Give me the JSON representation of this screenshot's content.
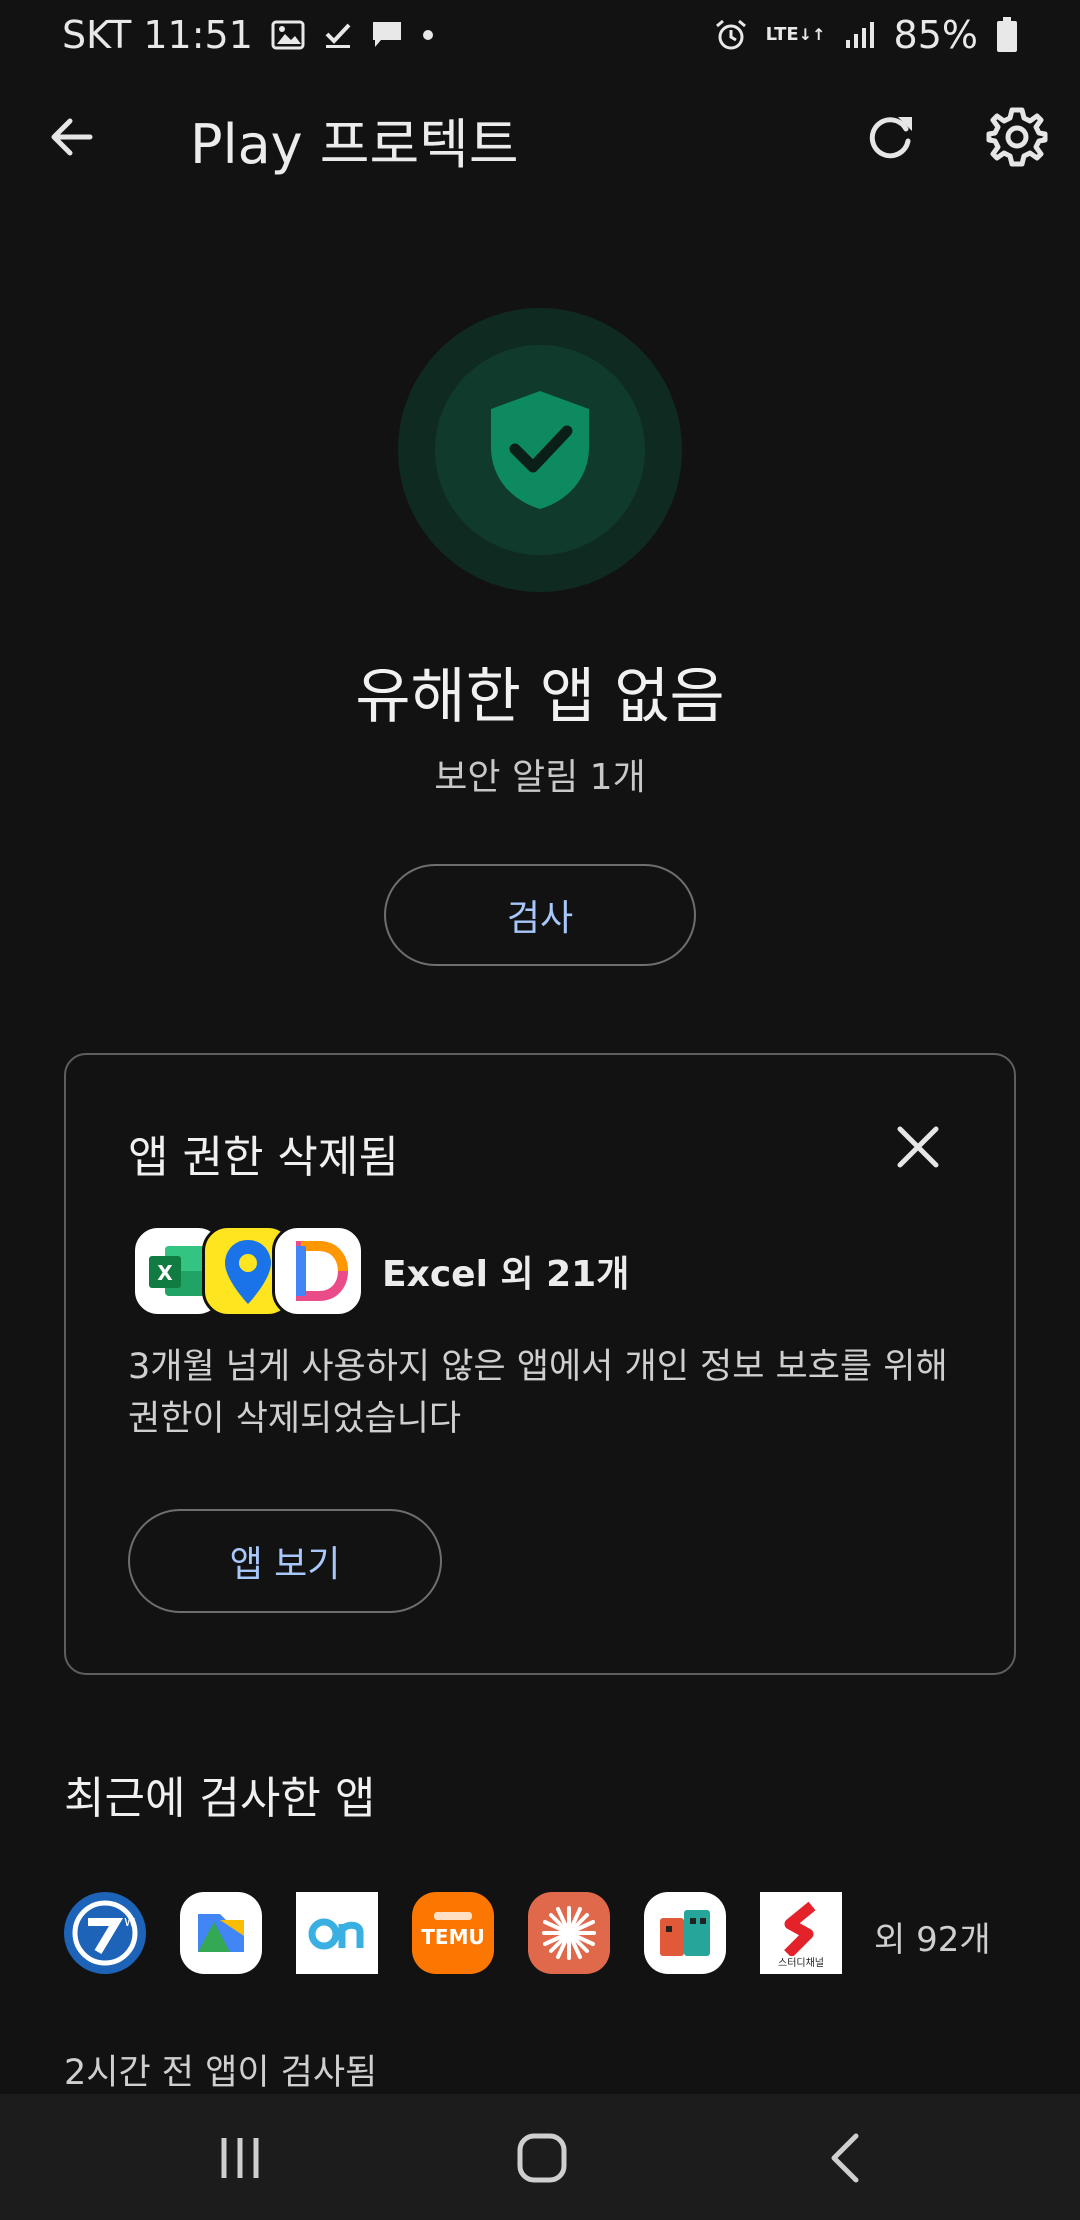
{
  "status_bar": {
    "carrier_time": "SKT 11:51",
    "lte": "LTE",
    "battery": "85%",
    "icons": [
      "gallery-icon",
      "checkbox-icon",
      "message-icon",
      "dot-icon",
      "alarm-icon",
      "lte-icon",
      "signal-icon",
      "battery-icon"
    ]
  },
  "app_bar": {
    "title": "Play 프로텍트"
  },
  "hero": {
    "title": "유해한 앱 없음",
    "subtitle": "보안 알림 1개",
    "scan_label": "검사",
    "accent": "#0d8a5f"
  },
  "card": {
    "title": "앱 권한 삭제됨",
    "apps_label": "Excel 외 21개",
    "description": "3개월 넘게 사용하지 않은 앱에서 개인 정보 보호를 위해 권한이 삭제되었습니다",
    "view_label": "앱 보기"
  },
  "recent": {
    "title": "최근에 검사한 앱",
    "more_label": "외 92개",
    "scan_time": "2시간 전 앱이 검사됨"
  },
  "colors": {
    "button_text": "#a8c7fa",
    "background": "#121212"
  }
}
